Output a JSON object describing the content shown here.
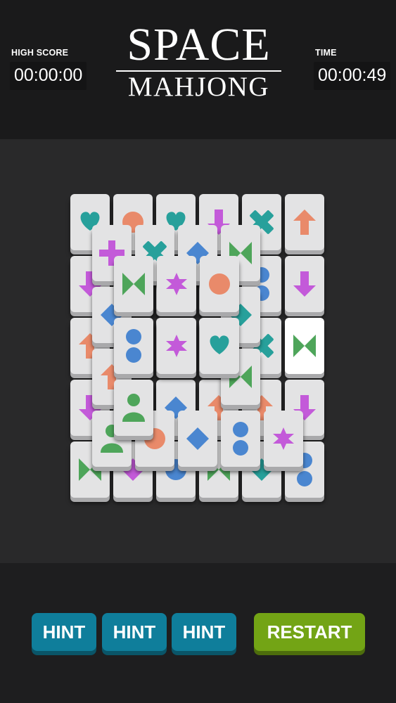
{
  "header": {
    "title_line1": "SPACE",
    "title_line2": "MAHJONG",
    "high_score_label": "HIGH SCORE",
    "high_score_value": "00:00:00",
    "time_label": "TIME",
    "time_value": "00:00:49"
  },
  "buttons": {
    "hint_1": "HINT",
    "hint_2": "HINT",
    "hint_3": "HINT",
    "restart": "RESTART"
  },
  "colors": {
    "teal": "#27a09b",
    "orange": "#e98a6a",
    "purple": "#c35ad9",
    "blue": "#4a86d0",
    "green": "#4ea55a",
    "hint_button": "#0f7e9b",
    "restart_button": "#73a415"
  },
  "tiles": [
    {
      "layer": 0,
      "row": 0,
      "col": 0,
      "symbol": "heart-icon",
      "color": "teal"
    },
    {
      "layer": 0,
      "row": 0,
      "col": 1,
      "symbol": "circle-icon",
      "color": "orange"
    },
    {
      "layer": 0,
      "row": 0,
      "col": 2,
      "symbol": "heart-icon",
      "color": "teal"
    },
    {
      "layer": 0,
      "row": 0,
      "col": 3,
      "symbol": "arrow-down-icon",
      "color": "purple"
    },
    {
      "layer": 0,
      "row": 0,
      "col": 4,
      "symbol": "x-cross-icon",
      "color": "teal"
    },
    {
      "layer": 0,
      "row": 0,
      "col": 5,
      "symbol": "arrow-up-icon",
      "color": "orange"
    },
    {
      "layer": 0,
      "row": 1,
      "col": 0,
      "symbol": "arrow-down-icon",
      "color": "purple"
    },
    {
      "layer": 0,
      "row": 1,
      "col": 1,
      "symbol": "diamond-icon",
      "color": "blue"
    },
    {
      "layer": 0,
      "row": 1,
      "col": 2,
      "symbol": "star-icon",
      "color": "purple"
    },
    {
      "layer": 0,
      "row": 1,
      "col": 3,
      "symbol": "star-icon",
      "color": "purple"
    },
    {
      "layer": 0,
      "row": 1,
      "col": 4,
      "symbol": "two-dots-icon",
      "color": "blue"
    },
    {
      "layer": 0,
      "row": 1,
      "col": 5,
      "symbol": "arrow-down-icon",
      "color": "purple"
    },
    {
      "layer": 0,
      "row": 2,
      "col": 0,
      "symbol": "arrow-up-icon",
      "color": "orange"
    },
    {
      "layer": 0,
      "row": 2,
      "col": 1,
      "symbol": "diamond-icon",
      "color": "blue"
    },
    {
      "layer": 0,
      "row": 2,
      "col": 2,
      "symbol": "circle-icon",
      "color": "orange"
    },
    {
      "layer": 0,
      "row": 2,
      "col": 3,
      "symbol": "diamond-icon",
      "color": "blue"
    },
    {
      "layer": 0,
      "row": 2,
      "col": 4,
      "symbol": "x-cross-icon",
      "color": "teal"
    },
    {
      "layer": 0,
      "row": 2,
      "col": 5,
      "symbol": "bowtie-icon",
      "color": "green",
      "selected": true
    },
    {
      "layer": 0,
      "row": 3,
      "col": 0,
      "symbol": "arrow-down-icon",
      "color": "purple"
    },
    {
      "layer": 0,
      "row": 3,
      "col": 1,
      "symbol": "heart-icon",
      "color": "teal"
    },
    {
      "layer": 0,
      "row": 3,
      "col": 2,
      "symbol": "diamond-icon",
      "color": "blue"
    },
    {
      "layer": 0,
      "row": 3,
      "col": 3,
      "symbol": "arrow-up-icon",
      "color": "orange"
    },
    {
      "layer": 0,
      "row": 3,
      "col": 4,
      "symbol": "arrow-up-icon",
      "color": "orange"
    },
    {
      "layer": 0,
      "row": 3,
      "col": 5,
      "symbol": "arrow-down-icon",
      "color": "purple"
    },
    {
      "layer": 0,
      "row": 4,
      "col": 0,
      "symbol": "bowtie-icon",
      "color": "green"
    },
    {
      "layer": 0,
      "row": 4,
      "col": 1,
      "symbol": "diamond-icon",
      "color": "purple"
    },
    {
      "layer": 0,
      "row": 4,
      "col": 2,
      "symbol": "circle-icon",
      "color": "blue"
    },
    {
      "layer": 0,
      "row": 4,
      "col": 3,
      "symbol": "bowtie-icon",
      "color": "green"
    },
    {
      "layer": 0,
      "row": 4,
      "col": 4,
      "symbol": "diamond-icon",
      "color": "teal"
    },
    {
      "layer": 0,
      "row": 4,
      "col": 5,
      "symbol": "two-dots-icon",
      "color": "blue"
    },
    {
      "layer": 1,
      "row": 0,
      "col": 0,
      "symbol": "plus-icon",
      "color": "purple"
    },
    {
      "layer": 1,
      "row": 0,
      "col": 1,
      "symbol": "x-cross-icon",
      "color": "teal"
    },
    {
      "layer": 1,
      "row": 0,
      "col": 2,
      "symbol": "diamond-icon",
      "color": "blue"
    },
    {
      "layer": 1,
      "row": 0,
      "col": 3,
      "symbol": "bowtie-icon",
      "color": "green"
    },
    {
      "layer": 1,
      "row": 1,
      "col": 0,
      "symbol": "diamond-icon",
      "color": "blue"
    },
    {
      "layer": 1,
      "row": 1,
      "col": 3,
      "symbol": "diamond-icon",
      "color": "teal"
    },
    {
      "layer": 1,
      "row": 2,
      "col": 0,
      "symbol": "arrow-up-icon",
      "color": "orange"
    },
    {
      "layer": 1,
      "row": 2,
      "col": 3,
      "symbol": "bowtie-icon",
      "color": "green"
    },
    {
      "layer": 1,
      "row": 3,
      "col": 0,
      "symbol": "person-icon",
      "color": "green"
    },
    {
      "layer": 1,
      "row": 3,
      "col": 1,
      "symbol": "circle-icon",
      "color": "orange"
    },
    {
      "layer": 1,
      "row": 3,
      "col": 2,
      "symbol": "diamond-icon",
      "color": "blue"
    },
    {
      "layer": 1,
      "row": 3,
      "col": 3,
      "symbol": "two-dots-icon",
      "color": "blue"
    },
    {
      "layer": 1,
      "row": 3,
      "col": 4,
      "symbol": "star-icon",
      "color": "purple"
    },
    {
      "layer": 2,
      "row": 0,
      "col": 0,
      "symbol": "bowtie-icon",
      "color": "green"
    },
    {
      "layer": 2,
      "row": 0,
      "col": 1,
      "symbol": "star-icon",
      "color": "purple"
    },
    {
      "layer": 2,
      "row": 0,
      "col": 2,
      "symbol": "circle-icon",
      "color": "orange"
    },
    {
      "layer": 2,
      "row": 1,
      "col": 0,
      "symbol": "two-dots-icon",
      "color": "blue"
    },
    {
      "layer": 2,
      "row": 1,
      "col": 1,
      "symbol": "star-icon",
      "color": "purple"
    },
    {
      "layer": 2,
      "row": 1,
      "col": 2,
      "symbol": "heart-icon",
      "color": "teal"
    },
    {
      "layer": 2,
      "row": 2,
      "col": 0,
      "symbol": "person-icon",
      "color": "green"
    }
  ]
}
